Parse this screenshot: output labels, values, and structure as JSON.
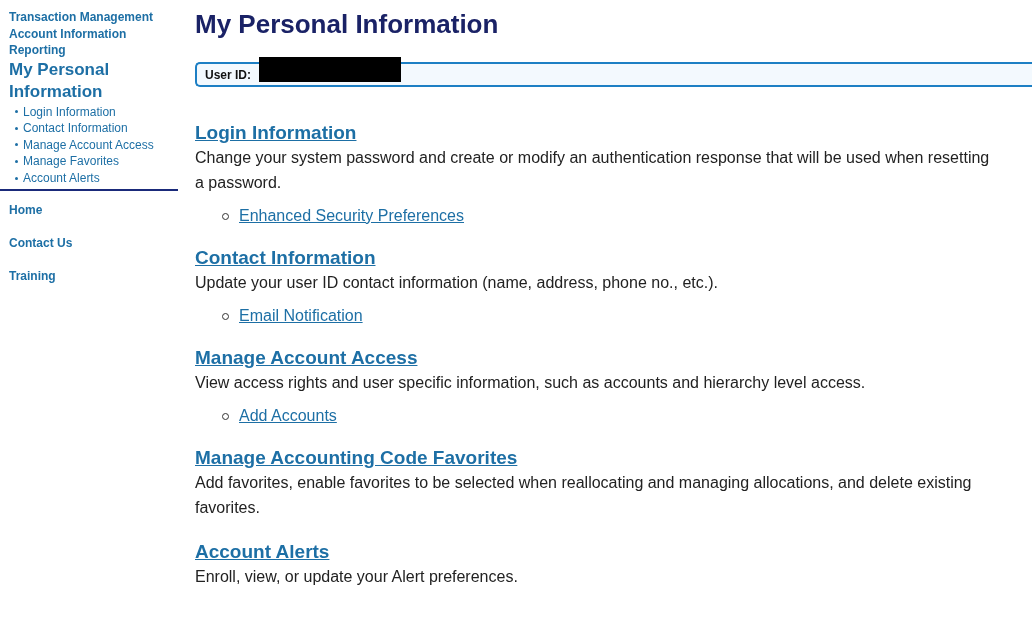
{
  "sidebar": {
    "top_links": [
      "Transaction Management",
      "Account Information",
      "Reporting"
    ],
    "current": "My Personal Information",
    "sub_items": [
      "Login Information",
      "Contact Information",
      "Manage Account Access",
      "Manage Favorites",
      "Account Alerts"
    ],
    "bottom_links": [
      "Home",
      "Contact Us",
      "Training"
    ]
  },
  "page_title": "My Personal Information",
  "user_id": {
    "label": "User ID:",
    "redacted": true
  },
  "sections": [
    {
      "heading": "Login Information",
      "description": "Change your system password and create or modify an authentication response that will be used when resetting a password.",
      "links": [
        "Enhanced Security Preferences"
      ]
    },
    {
      "heading": "Contact Information",
      "description": "Update your user ID contact information (name, address, phone no., etc.).",
      "links": [
        "Email Notification"
      ]
    },
    {
      "heading": "Manage Account Access",
      "description": "View access rights and user specific information, such as accounts and hierarchy level access.",
      "links": [
        "Add Accounts"
      ]
    },
    {
      "heading": "Manage Accounting Code Favorites",
      "description": "Add favorites, enable favorites to be selected when reallocating and managing allocations, and delete existing favorites."
    },
    {
      "heading": "Account Alerts",
      "description": "Enroll, view, or update your Alert preferences."
    }
  ]
}
